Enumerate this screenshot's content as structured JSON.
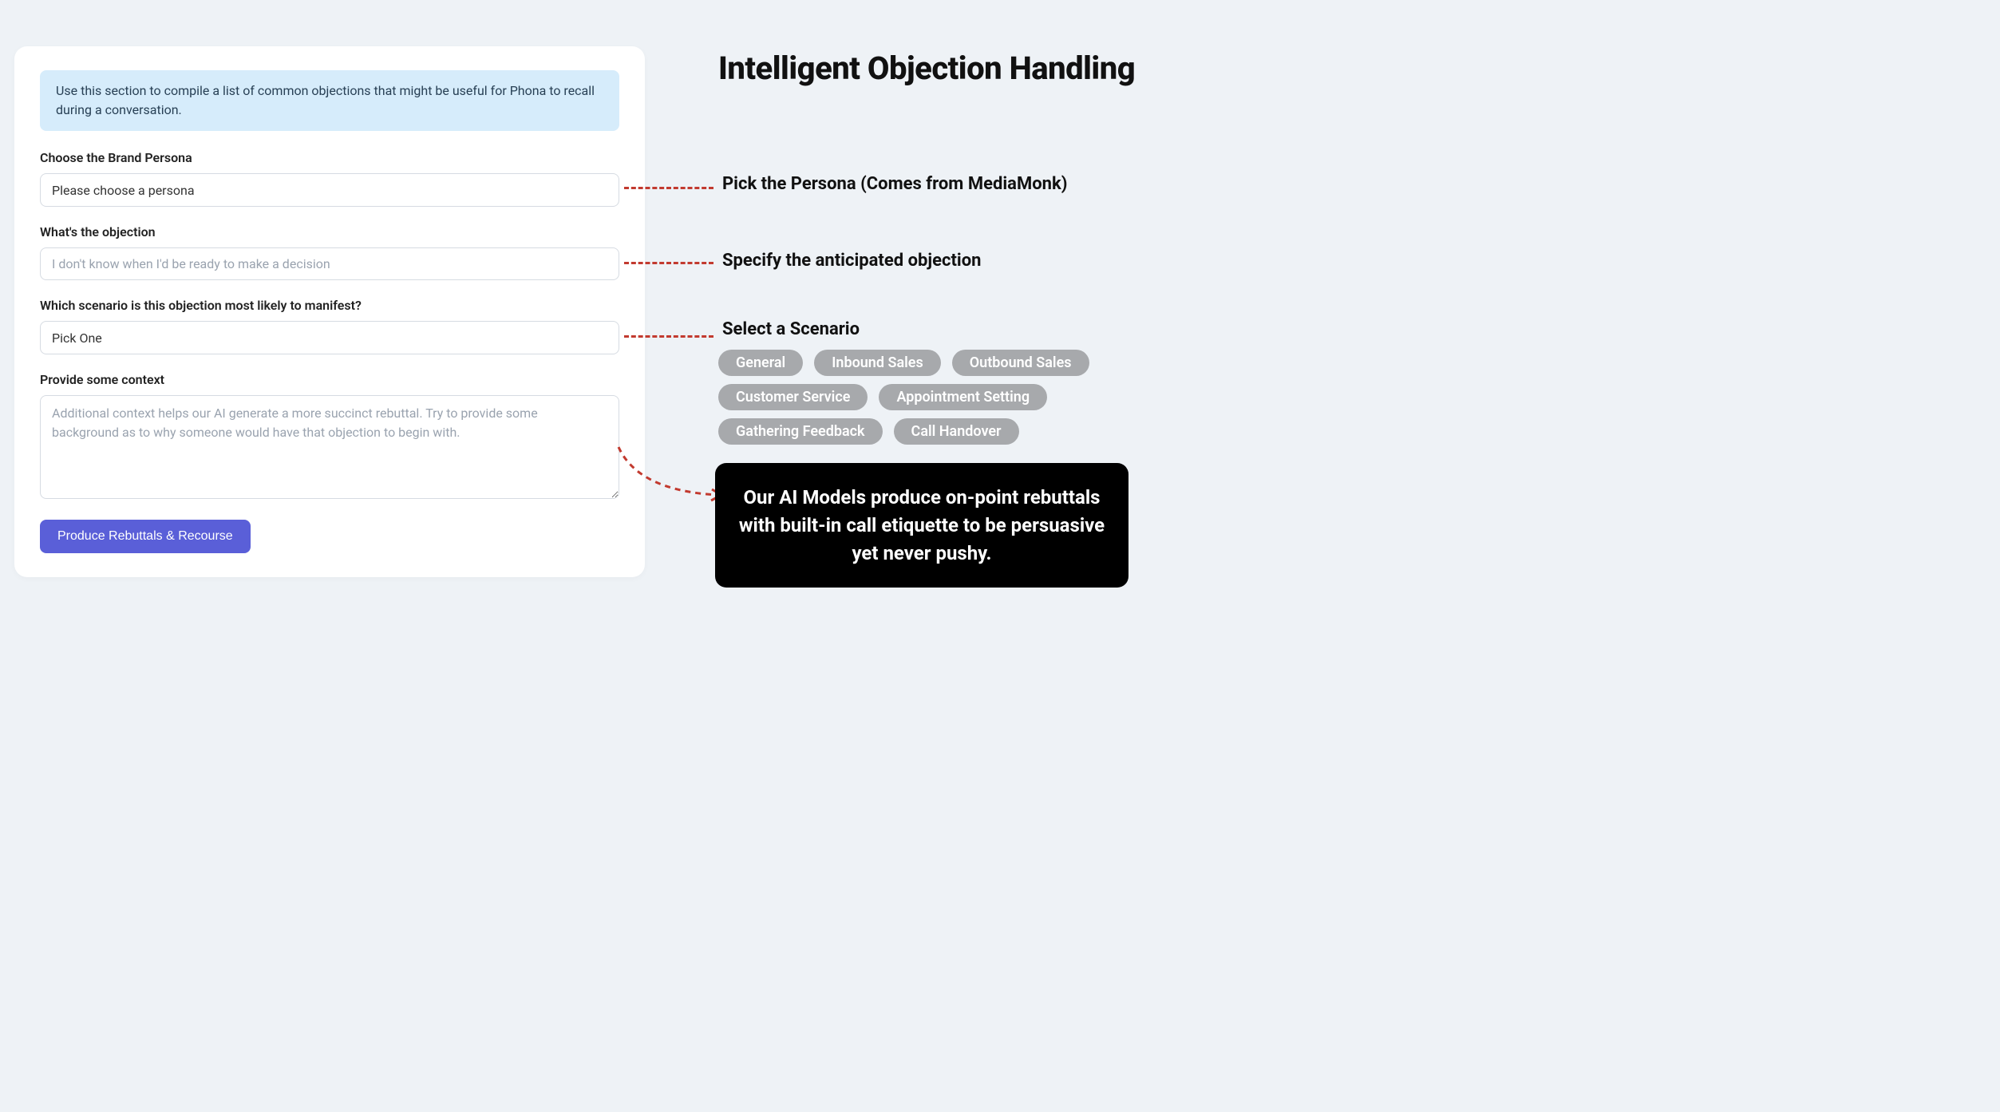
{
  "form": {
    "info_banner": "Use this section to compile a list of common objections that might be useful for Phona to recall during a conversation.",
    "persona_label": "Choose the Brand Persona",
    "persona_value": "Please choose a persona",
    "objection_label": "What's the objection",
    "objection_placeholder": "I don't know when I'd be ready to make a decision",
    "scenario_label": "Which scenario is this objection most likely to manifest?",
    "scenario_value": "Pick One",
    "context_label": "Provide some context",
    "context_placeholder": "Additional context helps our AI generate a more succinct rebuttal. Try to provide some background as to why someone would have that objection to begin with.",
    "submit_label": "Produce Rebuttals & Recourse"
  },
  "side": {
    "title": "Intelligent Objection Handling",
    "annot_persona": "Pick the Persona (Comes from MediaMonk)",
    "annot_objection": "Specify the anticipated objection",
    "annot_scenario": "Select a Scenario",
    "pills": [
      "General",
      "Inbound Sales",
      "Outbound Sales",
      "Customer Service",
      "Appointment Setting",
      "Gathering Feedback",
      "Call Handover"
    ],
    "callout": "Our AI Models produce on-point rebuttals with built-in call etiquette to be persuasive yet never pushy."
  },
  "colors": {
    "accent_button": "#5a5fd8",
    "info_bg": "#d6ecfb",
    "pill_bg": "#a7a9ac",
    "dash": "#c23a2f"
  }
}
